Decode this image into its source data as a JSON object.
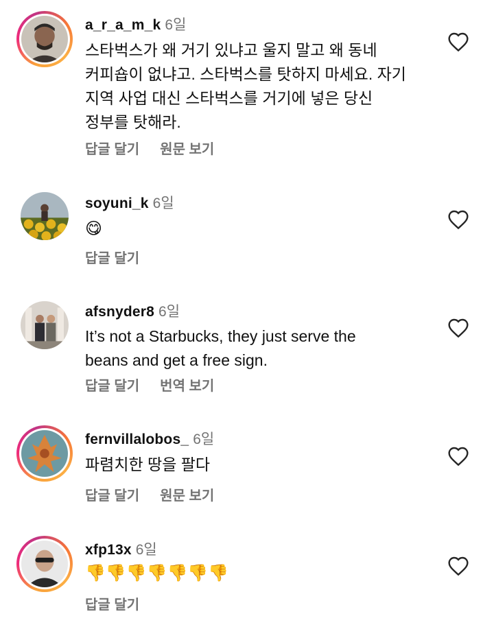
{
  "comments": [
    {
      "username": "a_r_a_m_k",
      "time": "6일",
      "text": "스타벅스가 왜 거기 있냐고 울지 말고 왜 동네\n커피숍이 없냐고. 스타벅스를 탓하지 마세요. 자기\n지역 사업 대신 스타벅스를 거기에 넣은 당신\n정부를 탓해라.",
      "reply_label": "답글 달기",
      "extra_label": "원문 보기",
      "has_story_ring": true
    },
    {
      "username": "soyuni_k",
      "time": "6일",
      "text": "😋",
      "reply_label": "답글 달기",
      "has_story_ring": false
    },
    {
      "username": "afsnyder8",
      "time": "6일",
      "text": "It’s not a Starbucks, they just serve the\nbeans and get a free sign.",
      "reply_label": "답글 달기",
      "extra_label": "번역 보기",
      "has_story_ring": false
    },
    {
      "username": "fernvillalobos_",
      "time": "6일",
      "text": "파렴치한 땅을 팔다",
      "reply_label": "답글 달기",
      "extra_label": "원문 보기",
      "has_story_ring": true
    },
    {
      "username": "xfp13x",
      "time": "6일",
      "text": "👎👎👎👎👎👎👎",
      "reply_label": "답글 달기",
      "has_story_ring": true
    }
  ],
  "icons": {
    "like": "heart-outline-icon"
  },
  "colors": {
    "text": "#111111",
    "muted": "#737373",
    "ring_start": "#f9a13a",
    "ring_end": "#c13584"
  }
}
